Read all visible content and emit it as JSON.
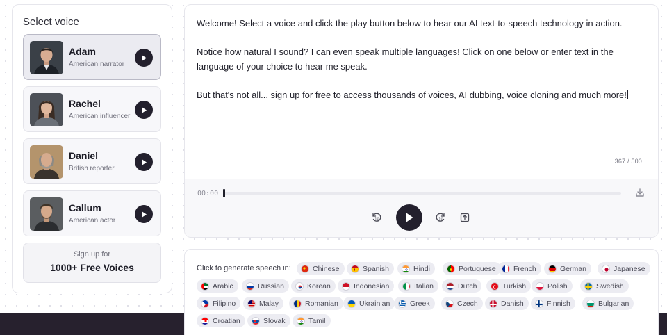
{
  "voice_panel": {
    "title": "Select voice",
    "voices": [
      {
        "name": "Adam",
        "desc": "American narrator",
        "selected": true
      },
      {
        "name": "Rachel",
        "desc": "American influencer",
        "selected": false
      },
      {
        "name": "Daniel",
        "desc": "British reporter",
        "selected": false
      },
      {
        "name": "Callum",
        "desc": "American actor",
        "selected": false
      }
    ],
    "signup": {
      "line1": "Sign up for",
      "line2": "1000+ Free Voices"
    }
  },
  "editor": {
    "paragraphs": [
      "Welcome! Select a voice and click the play button below to hear our AI text-to-speech technology in action.",
      "Notice how natural I sound? I can even speak multiple languages! Click on one below or enter text in the language of your choice to hear me speak.",
      "But that's not all... sign up for free to access thousands of voices, AI dubbing, voice cloning and much more!"
    ],
    "char_count": "367 / 500"
  },
  "player": {
    "time": "00:00",
    "progress": 0,
    "icons": {
      "rewind": "rewind-10-icon",
      "play": "play-icon",
      "forward": "forward-10-icon",
      "share": "share-icon",
      "download": "download-icon"
    }
  },
  "languages": {
    "intro": "Click to generate speech in:",
    "items": [
      {
        "label": "Chinese",
        "flag": "cn"
      },
      {
        "label": "Spanish",
        "flag": "es"
      },
      {
        "label": "Hindi",
        "flag": "in"
      },
      {
        "label": "Portuguese",
        "flag": "pt"
      },
      {
        "label": "French",
        "flag": "fr"
      },
      {
        "label": "German",
        "flag": "de"
      },
      {
        "label": "Japanese",
        "flag": "jp"
      },
      {
        "label": "Arabic",
        "flag": "ae"
      },
      {
        "label": "Russian",
        "flag": "ru"
      },
      {
        "label": "Korean",
        "flag": "kr"
      },
      {
        "label": "Indonesian",
        "flag": "id"
      },
      {
        "label": "Italian",
        "flag": "it"
      },
      {
        "label": "Dutch",
        "flag": "nl"
      },
      {
        "label": "Turkish",
        "flag": "tr"
      },
      {
        "label": "Polish",
        "flag": "pl"
      },
      {
        "label": "Swedish",
        "flag": "se"
      },
      {
        "label": "Filipino",
        "flag": "ph"
      },
      {
        "label": "Malay",
        "flag": "my"
      },
      {
        "label": "Romanian",
        "flag": "ro"
      },
      {
        "label": "Ukrainian",
        "flag": "ua"
      },
      {
        "label": "Greek",
        "flag": "gr"
      },
      {
        "label": "Czech",
        "flag": "cz"
      },
      {
        "label": "Danish",
        "flag": "dk"
      },
      {
        "label": "Finnish",
        "flag": "fi"
      },
      {
        "label": "Bulgarian",
        "flag": "bg"
      },
      {
        "label": "Croatian",
        "flag": "hr"
      },
      {
        "label": "Slovak",
        "flag": "sk"
      },
      {
        "label": "Tamil",
        "flag": "in"
      }
    ]
  },
  "colors": {
    "accent_dark": "#23202d",
    "footer_strip": "#27212e",
    "chip_bg": "#ececf2"
  }
}
